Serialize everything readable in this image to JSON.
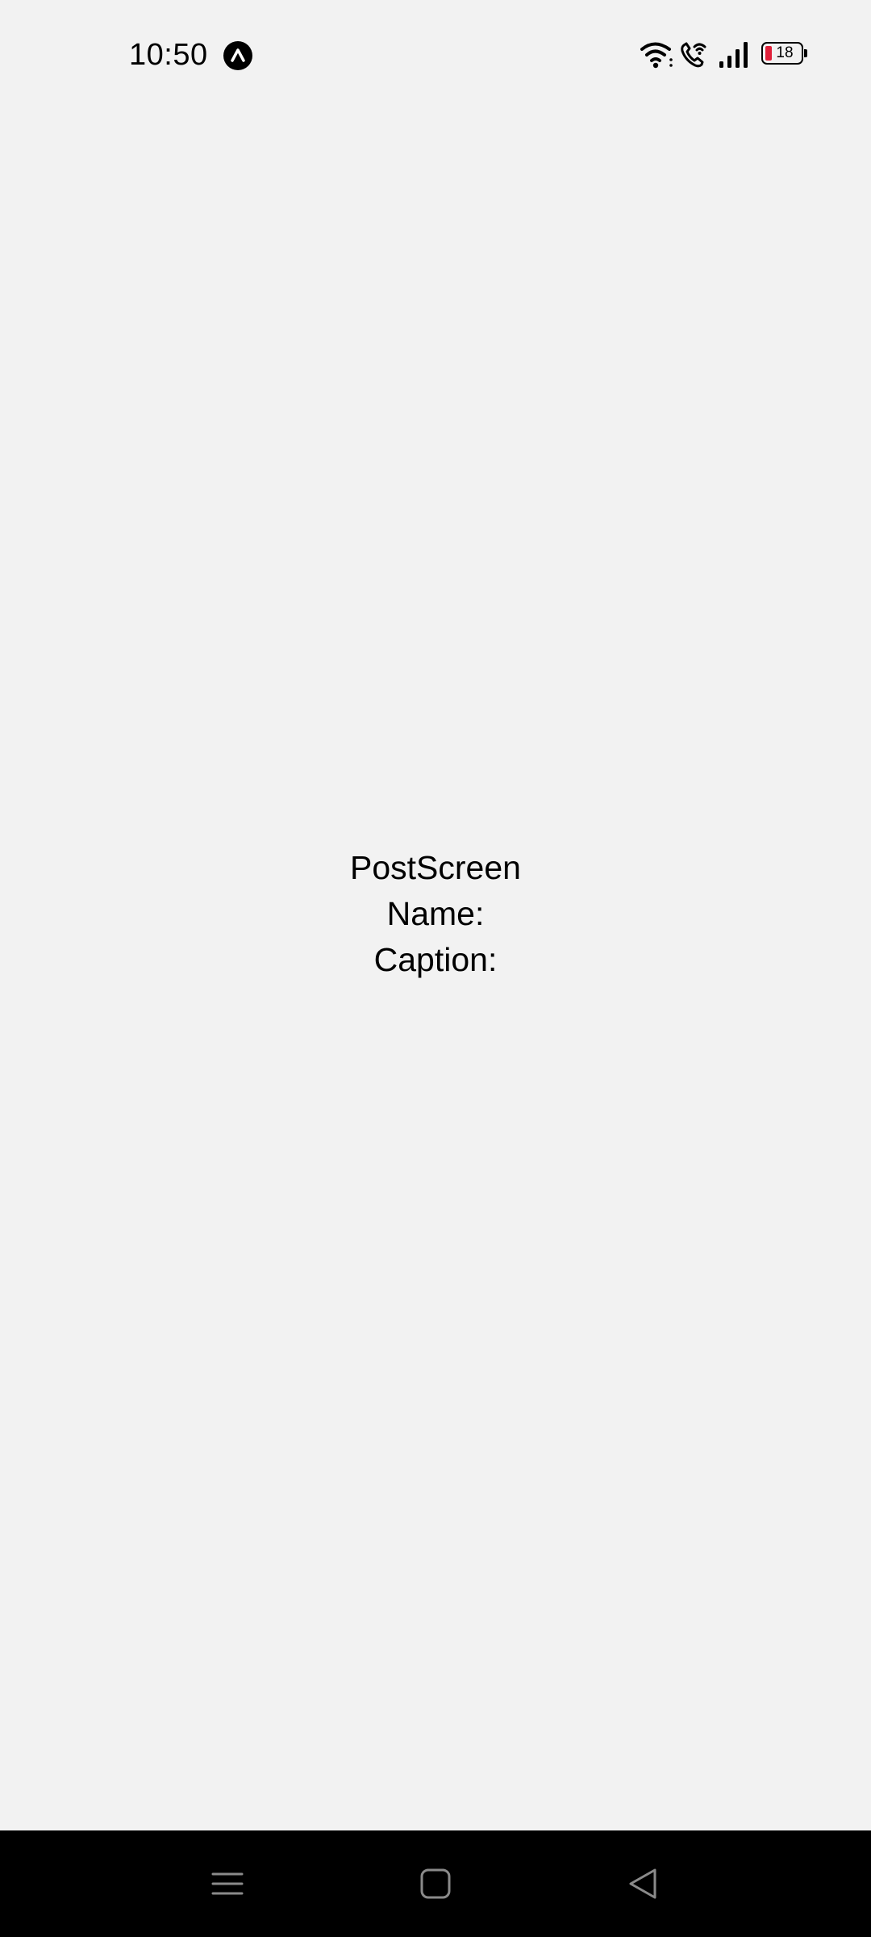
{
  "status_bar": {
    "time": "10:50",
    "battery_level": "18",
    "battery_color": "#e0203a"
  },
  "screen": {
    "title": "PostScreen",
    "name_label": "Name:",
    "caption_label": "Caption:"
  },
  "nav_bar": {
    "buttons": [
      "menu-icon",
      "home-icon",
      "back-icon"
    ]
  },
  "colors": {
    "background": "#f2f2f2",
    "nav_background": "#000000",
    "text": "#000000"
  }
}
